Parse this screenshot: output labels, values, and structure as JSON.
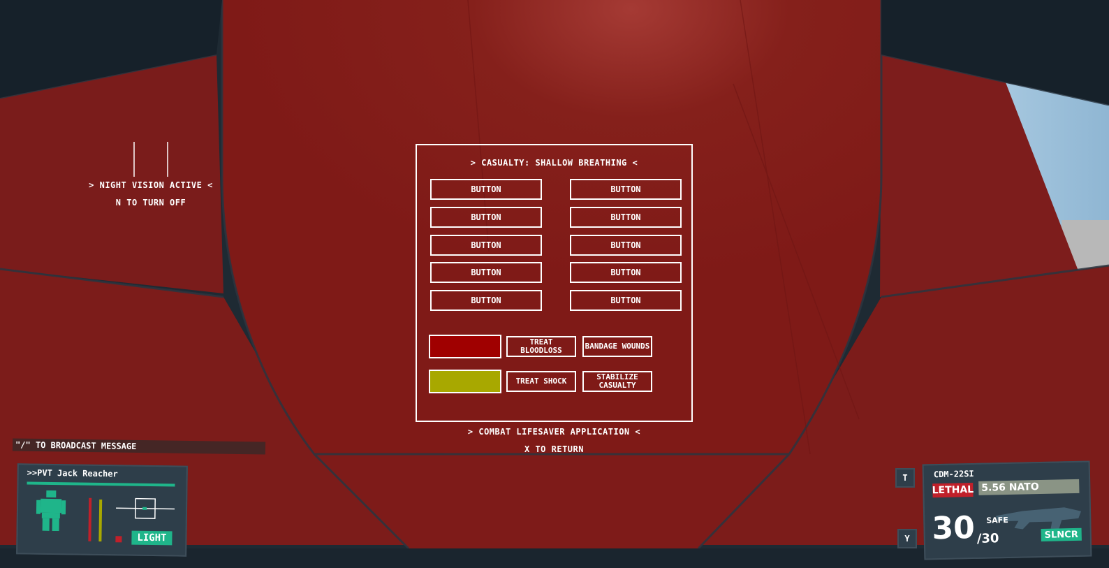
{
  "nightvision": {
    "status": "> NIGHT VISION ACTIVE <",
    "hint": "N TO TURN OFF"
  },
  "casualty": {
    "title": "> CASUALTY: SHALLOW BREATHING <",
    "buttons": [
      "BUTTON",
      "BUTTON",
      "BUTTON",
      "BUTTON",
      "BUTTON",
      "BUTTON",
      "BUTTON",
      "BUTTON",
      "BUTTON",
      "BUTTON"
    ],
    "status_colors": {
      "bloodloss": "#a00000",
      "shock": "#a8a800"
    },
    "actions": {
      "treat_bloodloss": "TREAT BLOODLOSS",
      "bandage_wounds": "BANDAGE WOUNDS",
      "treat_shock": "TREAT SHOCK",
      "stabilize_casualty": "STABILIZE CASUALTY"
    }
  },
  "footer": {
    "app_title": "> COMBAT LIFESAVER APPLICATION <",
    "return_hint": "X TO RETURN"
  },
  "chat": {
    "broadcast_hint": "\"/\" TO BROADCAST MESSAGE"
  },
  "player": {
    "name": ">>PVT Jack Reacher",
    "stance": "LIGHT",
    "health_color": "#1fb58a"
  },
  "weapon": {
    "name": "CDM-22SI",
    "ammo_mode": "LETHAL",
    "caliber": "5.56 NATO",
    "ammo_count": "30",
    "ammo_max": "/30",
    "fire_mode": "SAFE",
    "attachment": "SLNCR"
  },
  "keys": {
    "t": "T",
    "y": "Y"
  },
  "colors": {
    "accent": "#1fb58a",
    "lethal": "#c0202a",
    "background_red": "#8a1a18"
  }
}
